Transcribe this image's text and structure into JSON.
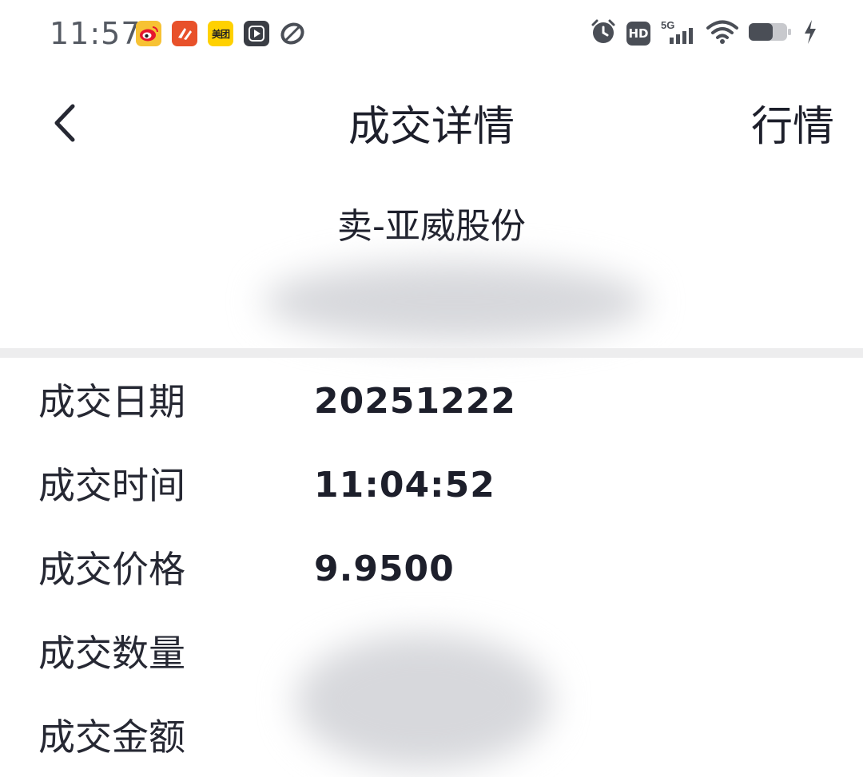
{
  "status_bar": {
    "time": "11:57",
    "notification_icons": [
      "weibo-icon",
      "app-red-icon",
      "meituan-icon",
      "video-play-icon",
      "ball-icon"
    ],
    "meituan_label": "美团",
    "network_label": "5G",
    "hd_label": "HD"
  },
  "header": {
    "title": "成交详情",
    "right_action": "行情"
  },
  "stock": {
    "heading": "卖-亚威股份"
  },
  "details": [
    {
      "label": "成交日期",
      "value": "20251222"
    },
    {
      "label": "成交时间",
      "value": "11:04:52"
    },
    {
      "label": "成交价格",
      "value": "9.9500"
    },
    {
      "label": "成交数量",
      "value": ""
    },
    {
      "label": "成交金额",
      "value": ""
    }
  ],
  "colors": {
    "text_primary": "#1d1f2b",
    "divider": "#ededee",
    "status_text": "#555a63"
  }
}
